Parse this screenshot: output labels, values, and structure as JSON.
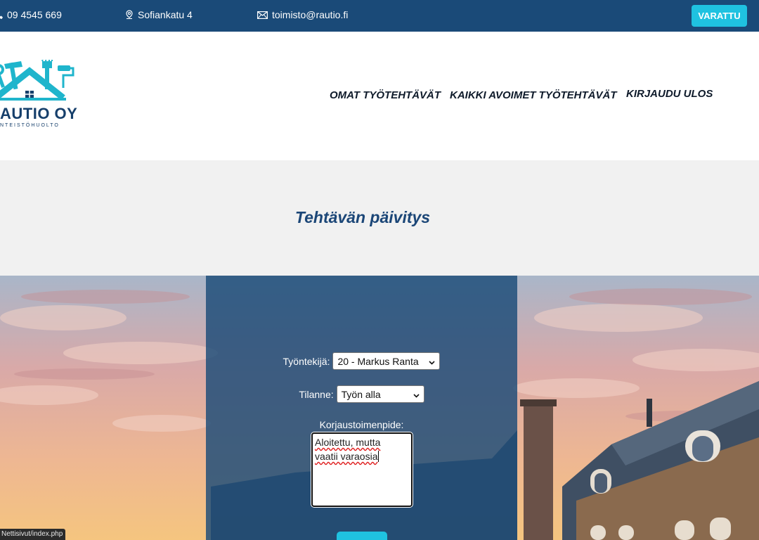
{
  "topbar": {
    "phone": "09 4545 669",
    "address": "Sofiankatu 4",
    "email": "toimisto@rautio.fi",
    "book_button": "VARATTU",
    "background_color": "#1a4a78",
    "accent_color": "#1fc2e0"
  },
  "logo": {
    "name": "AUTIO OY",
    "subtitle": "NTEISTÖHUOLTO"
  },
  "nav": {
    "items": [
      {
        "label": "OMAT TYÖTEHTÄVÄT"
      },
      {
        "label": "KAIKKI AVOIMET TYÖTEHTÄVÄT"
      },
      {
        "label": "KIRJAUDU ULOS"
      }
    ]
  },
  "page": {
    "title": "Tehtävän päivitys"
  },
  "form": {
    "employee_label": "Työntekijä:",
    "employee_value": "20 - Markus Ranta",
    "status_label": "Tilanne:",
    "status_value": "Työn alla",
    "action_label": "Korjaustoimenpide:",
    "action_text_line1": "Aloitettu, mutta",
    "action_text_line2": "vaatii varaosia"
  },
  "statusbar": {
    "url": "Nettisivut/index.php"
  },
  "icons": [
    "phone-icon",
    "location-pin-icon",
    "mail-icon",
    "chevron-down-icon",
    "logo-tools-house-icon"
  ]
}
